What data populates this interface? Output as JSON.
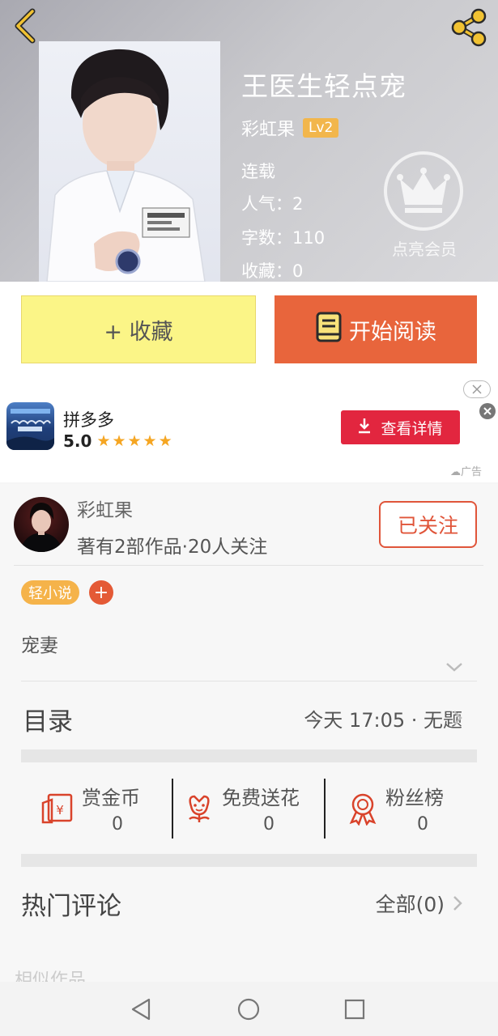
{
  "header": {
    "book_title": "王医生轻点宠",
    "author": "彩虹果",
    "level": "Lv2",
    "status": "连载",
    "popularity": "人气：2",
    "word_count": "字数：110",
    "favorites": "收藏：0",
    "vip_label": "点亮会员",
    "cover_badge_text": "市社区卫生服务中心"
  },
  "actions": {
    "favorite_label": "+ 收藏",
    "read_label": "开始阅读"
  },
  "ad": {
    "app_name": "拼多多",
    "rating": "5.0",
    "stars": "★★★★★",
    "cta_label": "查看详情",
    "ad_label": "广告"
  },
  "author_card": {
    "name": "彩虹果",
    "stats": "著有2部作品·20人关注",
    "follow_label": "已关注"
  },
  "tags": {
    "genre": "轻小说",
    "add_label": "+"
  },
  "synopsis": "宠妻",
  "toc": {
    "label": "目录",
    "latest": "今天 17:05 · 无题"
  },
  "stats": [
    {
      "label": "赏金币",
      "value": "0",
      "icon": "red-envelope-icon"
    },
    {
      "label": "免费送花",
      "value": "0",
      "icon": "flower-icon"
    },
    {
      "label": "粉丝榜",
      "value": "0",
      "icon": "medal-icon"
    }
  ],
  "comments": {
    "label": "热门评论",
    "all_label": "全部(0)"
  },
  "similar_label": "相似作品",
  "colors": {
    "accent_orange": "#e8653c",
    "favorite_yellow": "#fbf587",
    "level_badge": "#f2b64c",
    "ad_cta_red": "#e2263f",
    "icon_red": "#d9432b"
  }
}
